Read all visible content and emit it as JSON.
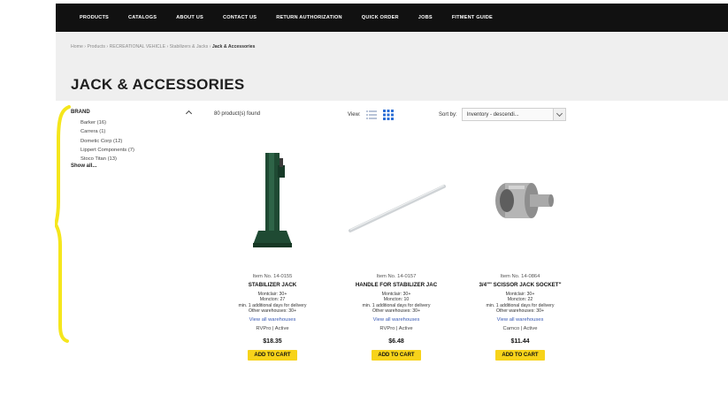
{
  "nav": {
    "items": [
      "PRODUCTS",
      "CATALOGS",
      "ABOUT US",
      "CONTACT US",
      "RETURN AUTHORIZATION",
      "QUICK ORDER",
      "JOBS",
      "FITMENT GUIDE"
    ]
  },
  "breadcrumb": {
    "items": [
      "Home",
      "Products",
      "RECREATIONAL VEHICLE",
      "Stabilizers & Jacks"
    ],
    "separator": "›",
    "current": "Jack & Accessories"
  },
  "page": {
    "title": "JACK & ACCESSORIES"
  },
  "filter": {
    "heading": "BRAND",
    "brands": [
      "Barker (16)",
      "Carrera (1)",
      "Dometic Corp (12)",
      "Lippert Components (7)",
      "Stoco Titan (13)"
    ],
    "show_all": "Show all..."
  },
  "toolbar": {
    "found": "80 product(s) found",
    "view_label": "View:",
    "sort_label": "Sort by:",
    "sort_value": "Inventory - descendi..."
  },
  "products": [
    {
      "item_no": "Item No. 14-0155",
      "name": "STABILIZER JACK",
      "stock_1": "Montclair: 30+",
      "stock_2": "Moncton: 27",
      "stock_3": "min. 1 additional days for delivery",
      "stock_4": "Other warehouses: 30+",
      "link": "View all warehouses",
      "brand": "RVPro | Active",
      "price": "$18.35",
      "cart": "ADD TO CART"
    },
    {
      "item_no": "Item No. 14-0157",
      "name": "HANDLE FOR STABILIZER JAC",
      "stock_1": "Montclair: 30+",
      "stock_2": "Moncton: 10",
      "stock_3": "min. 1 additional days for delivery",
      "stock_4": "Other warehouses: 30+",
      "link": "View all warehouses",
      "brand": "RVPro | Active",
      "price": "$6.48",
      "cart": "ADD TO CART"
    },
    {
      "item_no": "Item No. 14-0864",
      "name": "3/4\"\" SCISSOR JACK SOCKET\"",
      "stock_1": "Montclair: 30+",
      "stock_2": "Moncton: 22",
      "stock_3": "min. 1 additional days for delivery",
      "stock_4": "Other warehouses: 30+",
      "link": "View all warehouses",
      "brand": "Carnco | Active",
      "price": "$11.44",
      "cart": "ADD TO CART"
    }
  ],
  "colors": {
    "nav_bg": "#111111",
    "hero_bg": "#efefef",
    "cart_button": "#f7d31a",
    "link": "#3a5bb5",
    "active_view": "#2c6fd6",
    "annotation": "#f5e61c"
  },
  "icons": {
    "view_list": "list-view-icon",
    "view_grid": "grid-view-icon",
    "collapse": "chevron-up-icon",
    "sort_dropdown": "chevron-down-icon"
  }
}
